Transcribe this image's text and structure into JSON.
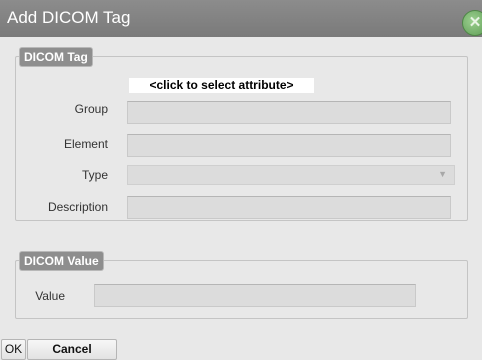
{
  "dialog": {
    "title": "Add DICOM Tag",
    "close_icon": "close-icon"
  },
  "tag_section": {
    "legend": "DICOM Tag",
    "select_attribute_label": "<click to select attribute>",
    "group_label": "Group",
    "group_value": "",
    "element_label": "Element",
    "element_value": "",
    "type_label": "Type",
    "type_value": "",
    "description_label": "Description",
    "description_value": ""
  },
  "value_section": {
    "legend": "DICOM Value",
    "value_label": "Value",
    "value_value": ""
  },
  "buttons": {
    "ok_label": "OK",
    "cancel_label": "Cancel"
  }
}
